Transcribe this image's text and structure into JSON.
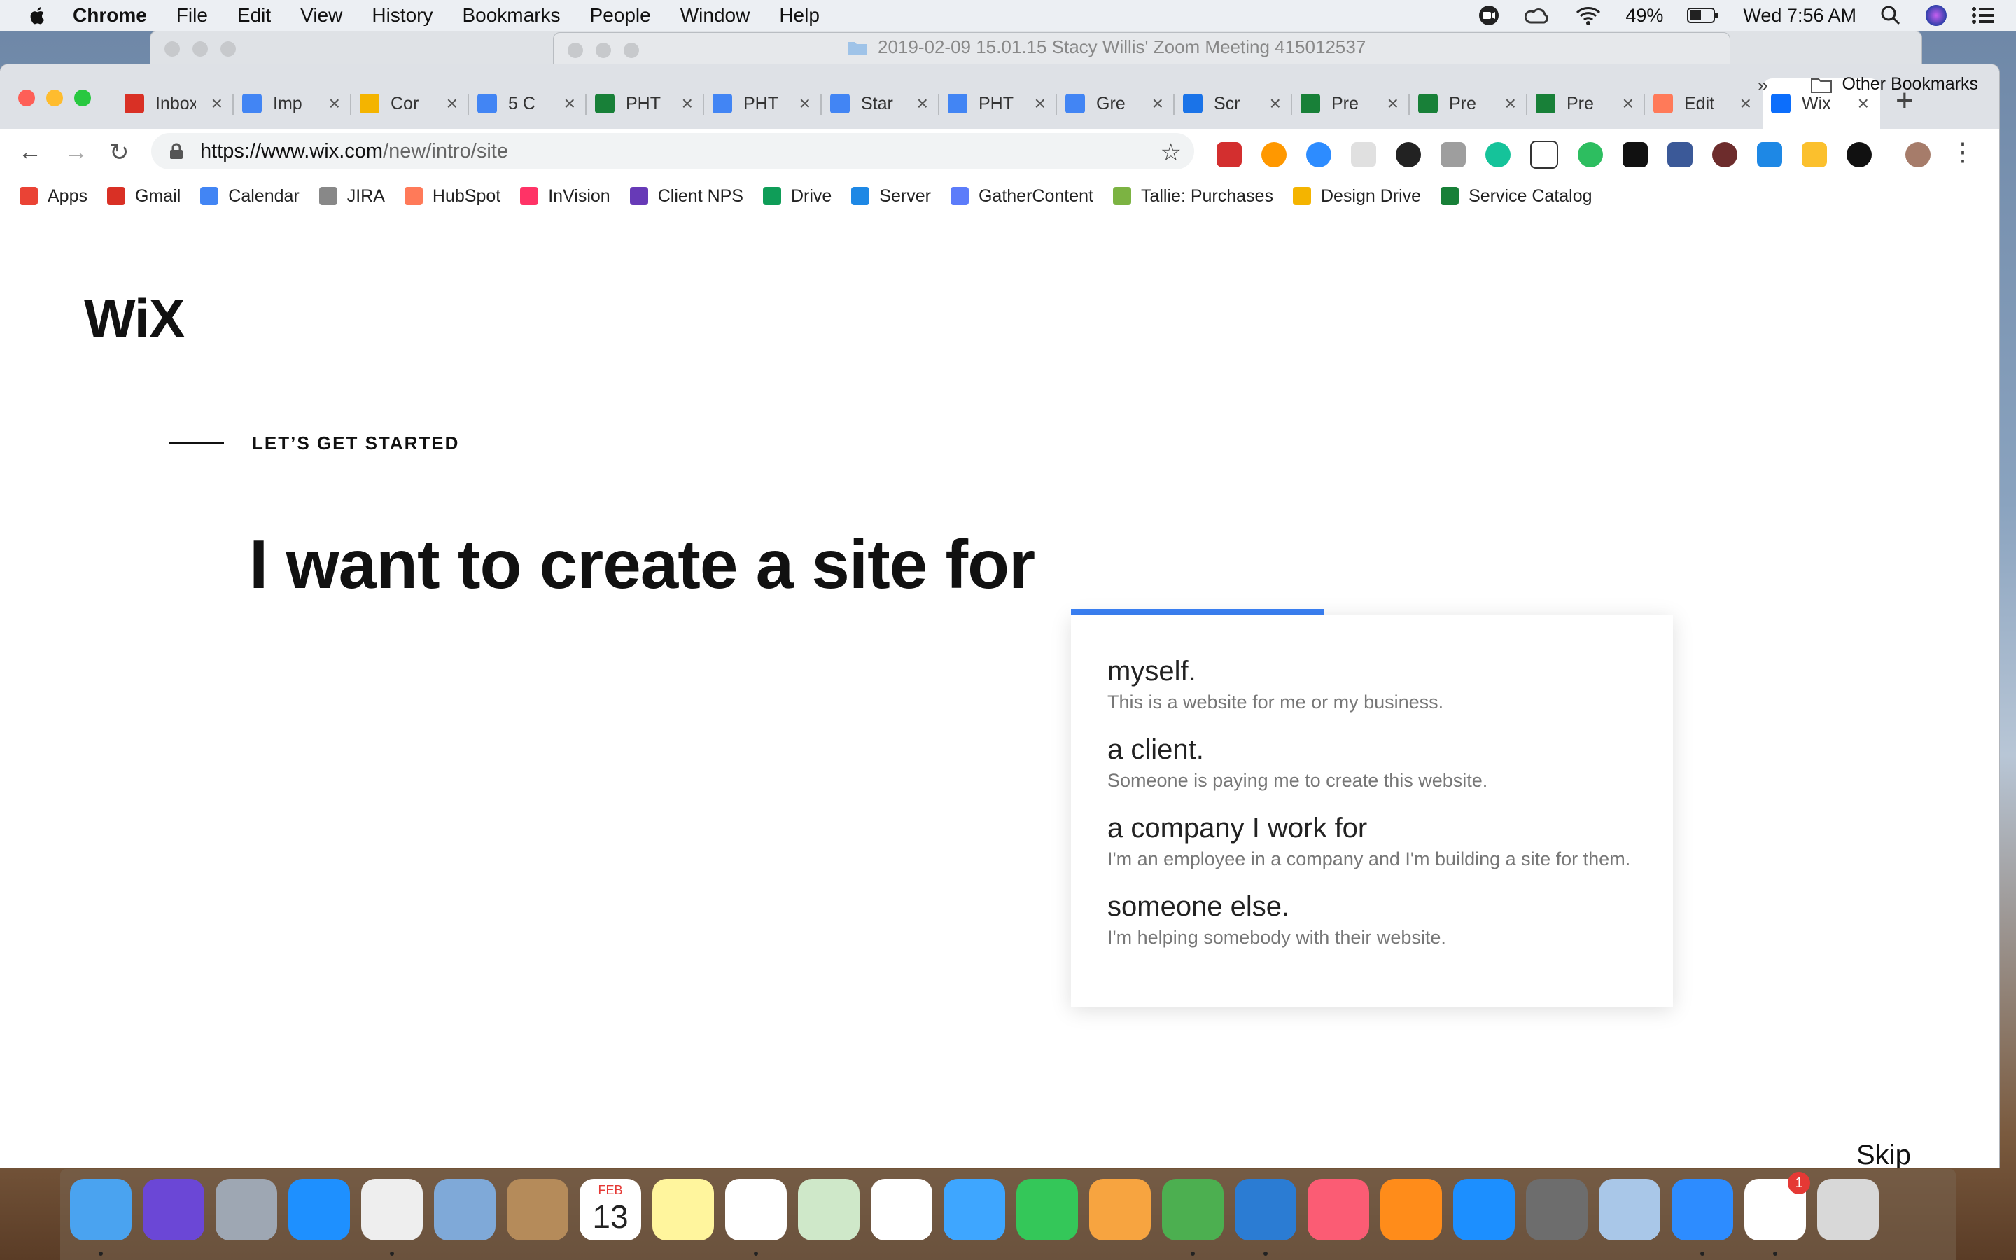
{
  "menubar": {
    "app": "Chrome",
    "items": [
      "File",
      "Edit",
      "View",
      "History",
      "Bookmarks",
      "People",
      "Window",
      "Help"
    ],
    "battery": "49%",
    "clock": "Wed 7:56 AM"
  },
  "background_window": {
    "title": "2019-02-09 15.01.15 Stacy Willis' Zoom Meeting 415012537"
  },
  "tabs": [
    {
      "label": "Inbox",
      "color": "#d93025"
    },
    {
      "label": "Imp",
      "color": "#4285f4"
    },
    {
      "label": "Cor",
      "color": "#f4b400"
    },
    {
      "label": "5 C",
      "color": "#4285f4"
    },
    {
      "label": "PHT",
      "color": "#188038"
    },
    {
      "label": "PHT",
      "color": "#4285f4"
    },
    {
      "label": "Star",
      "color": "#4285f4"
    },
    {
      "label": "PHT",
      "color": "#4285f4"
    },
    {
      "label": "Gre",
      "color": "#4285f4"
    },
    {
      "label": "Scr",
      "color": "#1a73e8"
    },
    {
      "label": "Pre",
      "color": "#188038"
    },
    {
      "label": "Pre",
      "color": "#188038"
    },
    {
      "label": "Pre",
      "color": "#188038"
    },
    {
      "label": "Edit",
      "color": "#ff7a59"
    },
    {
      "label": "Wix",
      "color": "#0c6efc"
    }
  ],
  "address": {
    "host": "https://www.wix.com",
    "path": "/new/intro/site"
  },
  "bookmarks": [
    {
      "label": "Apps",
      "color": "#ea4335"
    },
    {
      "label": "Gmail",
      "color": "#d93025"
    },
    {
      "label": "Calendar",
      "color": "#4285f4"
    },
    {
      "label": "JIRA",
      "color": "#888888"
    },
    {
      "label": "HubSpot",
      "color": "#ff7a59"
    },
    {
      "label": "InVision",
      "color": "#ff3366"
    },
    {
      "label": "Client NPS",
      "color": "#673ab7"
    },
    {
      "label": "Drive",
      "color": "#0f9d58"
    },
    {
      "label": "Server",
      "color": "#1e88e5"
    },
    {
      "label": "GatherContent",
      "color": "#5c7cfa"
    },
    {
      "label": "Tallie: Purchases",
      "color": "#7cb342"
    },
    {
      "label": "Design Drive",
      "color": "#f4b400"
    },
    {
      "label": "Service Catalog",
      "color": "#188038"
    }
  ],
  "other_bookmarks": "Other Bookmarks",
  "page": {
    "logo": "WiX",
    "eyebrow": "LET’S GET STARTED",
    "headline": "I want to create a site for",
    "progress": 0.42,
    "options": [
      {
        "title": "myself.",
        "desc": "This is a website for me or my business."
      },
      {
        "title": "a client.",
        "desc": "Someone is paying me to create this website."
      },
      {
        "title": "a company I work for",
        "desc": "I'm an employee in a company and I'm building a site for them."
      },
      {
        "title": "someone else.",
        "desc": "I'm helping somebody with their website."
      }
    ],
    "skip": "Skip"
  },
  "dock": [
    "finder-icon",
    "siri-icon",
    "launchpad-icon",
    "safari-icon",
    "chrome-icon",
    "mail-icon",
    "contacts-icon",
    "calendar-icon",
    "notes-icon",
    "reminders-icon",
    "maps-icon",
    "photos-icon",
    "messages-icon",
    "facetime-icon",
    "pages-icon",
    "numbers-icon",
    "keynote-icon",
    "itunes-icon",
    "books-icon",
    "appstore-icon",
    "preferences-icon",
    "preview-icon",
    "zoom-icon",
    "slack-icon",
    "trash-icon"
  ],
  "dock_calendar": {
    "month": "FEB",
    "day": "13"
  },
  "dock_badge": "1"
}
